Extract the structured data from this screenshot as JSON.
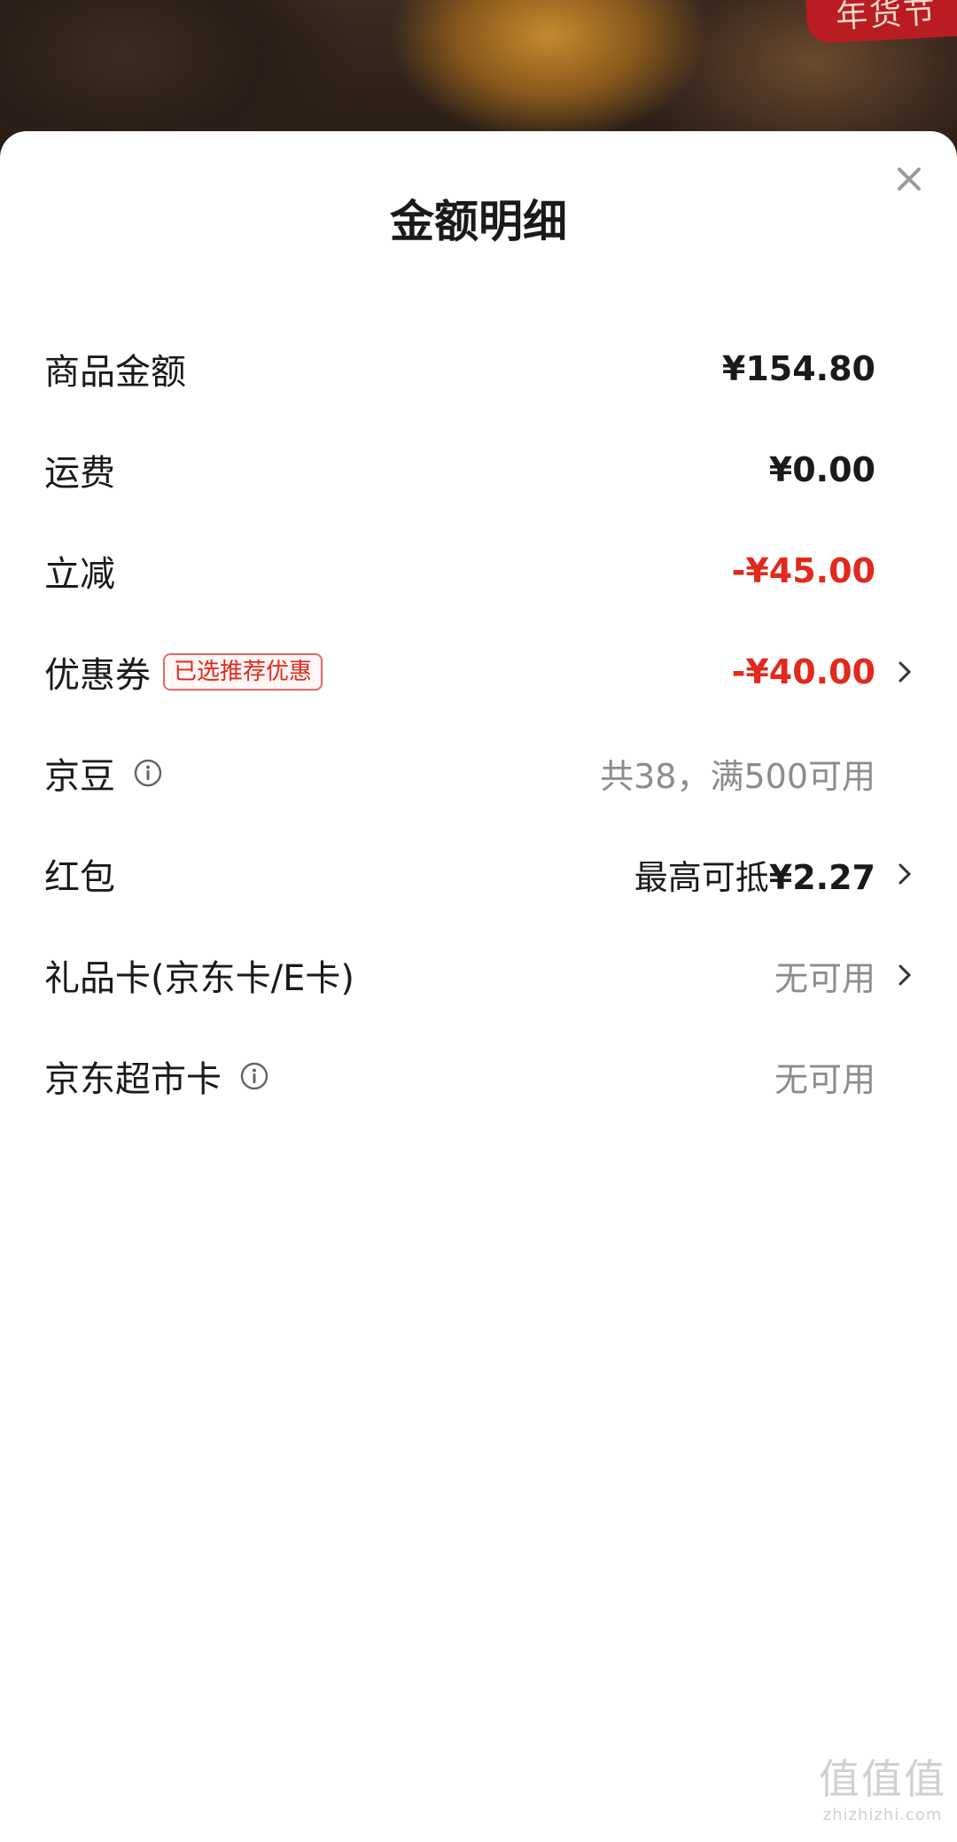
{
  "background": {
    "badge_text": "年货节"
  },
  "sheet": {
    "title": "金额明细",
    "close_icon": "close-icon"
  },
  "rows": [
    {
      "label": "商品金额",
      "value": "¥154.80",
      "style": "dark"
    },
    {
      "label": "运费",
      "value": "¥0.00",
      "style": "dark"
    },
    {
      "label": "立减",
      "value": "-¥45.00",
      "style": "red"
    },
    {
      "label": "优惠券",
      "tag": "已选推荐优惠",
      "value": "-¥40.00",
      "style": "red",
      "chevron": true
    },
    {
      "label": "京豆",
      "info": true,
      "value": "共38，满500可用",
      "style": "gray"
    },
    {
      "label": "红包",
      "value_prefix": "最高可抵",
      "value": "¥2.27",
      "style": "dark",
      "chevron": true
    },
    {
      "label": "礼品卡(京东卡/E卡)",
      "value": "无可用",
      "style": "gray",
      "chevron": true
    },
    {
      "label": "京东超市卡",
      "info": true,
      "value": "无可用",
      "style": "gray"
    }
  ],
  "watermark": {
    "top": "值值值",
    "bottom": "zhizhizhi.com"
  },
  "colors": {
    "accent_red": "#e3281c",
    "text_dark": "#1a1a1a",
    "text_gray": "#8c8c8c"
  }
}
